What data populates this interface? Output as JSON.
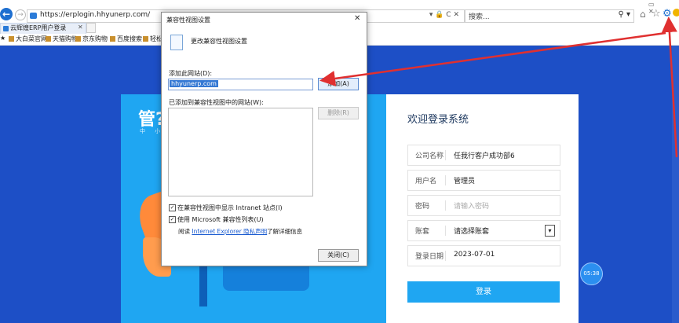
{
  "browser": {
    "url": "https://erplogin.hhyunerp.com/",
    "address_icons": "▾ 🔒 C ✕",
    "search_placeholder": "搜索...",
    "search_icon": "⚲ ▾",
    "window_controls": "▭ ✕",
    "tab_label": "云辉煌ERP用户登录",
    "tab_close": "✕",
    "favorites": [
      "大白菜官网",
      "天猫购物",
      "京东购物",
      "百度搜索",
      "轻松"
    ]
  },
  "login": {
    "banner_title": "管?",
    "banner_sub": "中 小",
    "title": "欢迎登录系统",
    "fields": [
      {
        "label": "公司名称",
        "value": "任我行客户成功部6"
      },
      {
        "label": "用户名",
        "value": "管理员"
      },
      {
        "label": "密码",
        "placeholder": "请输入密码"
      },
      {
        "label": "账套",
        "placeholder": "请选择账套"
      },
      {
        "label": "登录日期",
        "value": "2023-07-01"
      }
    ],
    "select_arrow": "▾",
    "button": "登录"
  },
  "timer": "05:38",
  "dialog": {
    "title": "兼容性视图设置",
    "close_glyph": "✕",
    "header": "更改兼容性视图设置",
    "add_site_label": "添加此网站(D):",
    "add_site_value": "hhyunerp.com",
    "add_button": "添加(A)",
    "list_label": "已添加到兼容性视图中的网站(W):",
    "remove_button": "删除(R)",
    "checkbox_intranet": "在兼容性视图中显示 Intranet 站点(I)",
    "checkbox_mslist": "使用 Microsoft 兼容性列表(U)",
    "checkbox_mark": "✓",
    "read_prefix": "阅读",
    "read_link": "Internet Explorer 隐私声明",
    "read_suffix": "了解详细信息",
    "close_button": "关闭(C)"
  },
  "colors": {
    "page_bg": "#1d4fc6",
    "accent_blue": "#1fa6f2",
    "arrow_red": "#e03030"
  },
  "icons": [
    "back-icon",
    "forward-icon",
    "home-icon",
    "star-icon",
    "gear-icon",
    "feedback-icon"
  ]
}
